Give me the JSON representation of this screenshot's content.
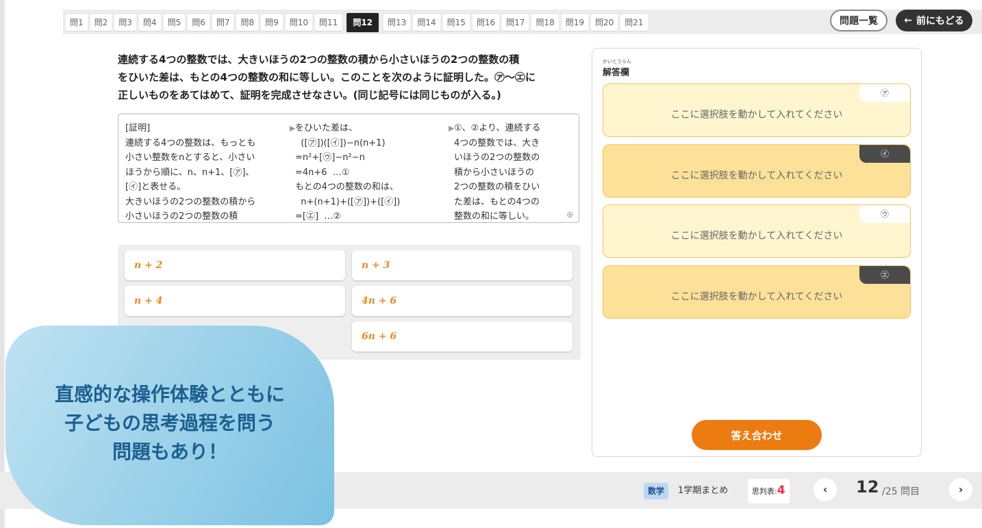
{
  "header": {
    "tabs": [
      "問1",
      "問2",
      "問3",
      "問4",
      "問5",
      "問6",
      "問7",
      "問8",
      "問9",
      "問10",
      "問11",
      "問12",
      "問13",
      "問14",
      "問15",
      "問16",
      "問17",
      "問18",
      "問19",
      "問20",
      "問21"
    ],
    "active_tab": "問12",
    "list_button": "問題一覧",
    "back_button": "前にもどる",
    "back_icon": "arrow-left-icon"
  },
  "question": {
    "line1": "連続する4つの整数では、大きいほうの2つの整数の積から小さいほうの2つの整数の積",
    "line2": "をひいた差は、もとの4つの整数の和に等しい。このことを次のように証明した。㋐〜㋓に",
    "line3": "正しいものをあてはめて、証明を完成させなさい。(同じ記号には同じものが入る。)"
  },
  "proof": {
    "col1": "[証明]\n連続する4つの整数は、もっとも\n小さい整数をnとすると、小さい\nほうから順に、n、n+1、[㋐]、\n[㋑]と表せる。\n大きいほうの2つの整数の積から\n小さいほうの2つの整数の積",
    "col2": "をひいた差は、\n  ([㋐])([㋑])−n(n+1)\n=n²+[㋒]−n²−n\n=4n+6  …①\nもとの4つの整数の和は、\n  n+(n+1)+([㋐])+([㋑])\n=[㋓]  …②",
    "col3": "①、②より、連続する\n4つの整数では、大き\nいほうの2つの整数の\n積から小さいほうの\n2つの整数の積をひい\nた差は、もとの4つの\n整数の和に等しい。"
  },
  "options": [
    "n + 2",
    "n + 3",
    "n + 4",
    "4n + 6",
    "6n + 6"
  ],
  "answer_panel": {
    "title_ruby": "かいとうらん",
    "title": "解答欄",
    "slots": [
      {
        "tag": "㋐",
        "text": "ここに選択肢を動かして入れてください"
      },
      {
        "tag": "㋑",
        "text": "ここに選択肢を動かして入れてください"
      },
      {
        "tag": "㋒",
        "text": "ここに選択肢を動かして入れてください"
      },
      {
        "tag": "㋓",
        "text": "ここに選択肢を動かして入れてください"
      }
    ],
    "check_button": "答え合わせ"
  },
  "footer": {
    "subject": "数学",
    "unit": "1学期まとめ",
    "criteria_label": "思判表:",
    "criteria_value": "4",
    "current_page": "12",
    "total_pages": "/25 問目"
  },
  "promo": {
    "line1": "直感的な操作体験とともに",
    "line2": "子どもの思考過程を問う",
    "line3": "問題もあり！"
  },
  "colors": {
    "accent_orange": "#ec7c12",
    "slot_light": "#fff6cf",
    "slot_dark": "#fde198",
    "promo_blue": "#7cc2e2"
  }
}
